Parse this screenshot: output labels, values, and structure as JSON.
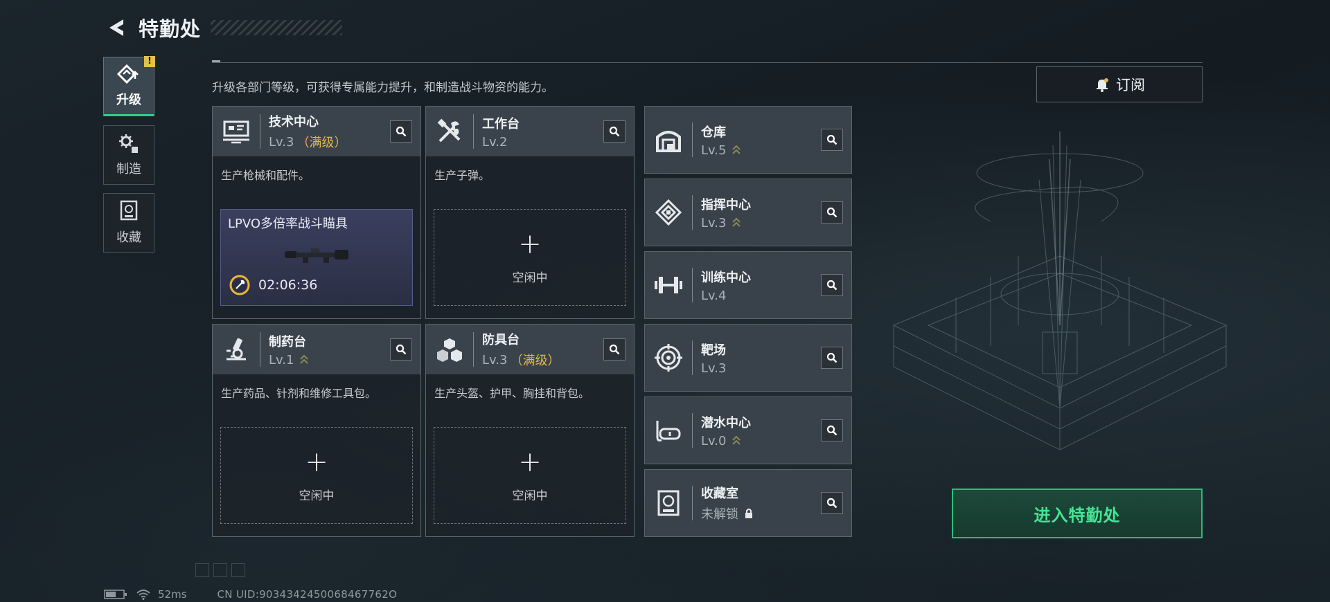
{
  "header": {
    "title": "特勤处"
  },
  "sidebar": {
    "items": [
      {
        "label": "升级",
        "icon": "upgrade-icon",
        "active": true,
        "badge": "!"
      },
      {
        "label": "制造",
        "icon": "gears-icon",
        "active": false
      },
      {
        "label": "收藏",
        "icon": "collection-icon",
        "active": false
      }
    ]
  },
  "description": "升级各部门等级，可获得专属能力提升，和制造战斗物资的能力。",
  "subscribe": {
    "label": "订阅",
    "icon": "bell-icon"
  },
  "departments": [
    {
      "name": "技术中心",
      "level": "Lv.3",
      "max_label": "（满级）",
      "desc": "生产枪械和配件。",
      "slot": {
        "state": "busy",
        "item": "LPVO多倍率战斗瞄具",
        "timer": "02:06:36"
      }
    },
    {
      "name": "工作台",
      "level": "Lv.2",
      "max_label": "",
      "desc": "生产子弹。",
      "slot": {
        "state": "idle",
        "label": "空闲中"
      }
    },
    {
      "name": "制药台",
      "level": "Lv.1",
      "max_label": "",
      "desc": "生产药品、针剂和维修工具包。",
      "slot": {
        "state": "idle",
        "label": "空闲中"
      }
    },
    {
      "name": "防具台",
      "level": "Lv.3",
      "max_label": "（满级）",
      "desc": "生产头盔、护甲、胸挂和背包。",
      "slot": {
        "state": "idle",
        "label": "空闲中"
      }
    }
  ],
  "facilities": [
    {
      "name": "仓库",
      "level": "Lv.5",
      "upgradable": true,
      "icon": "warehouse-icon"
    },
    {
      "name": "指挥中心",
      "level": "Lv.3",
      "upgradable": true,
      "icon": "command-icon"
    },
    {
      "name": "训练中心",
      "level": "Lv.4",
      "upgradable": false,
      "icon": "dumbbell-icon"
    },
    {
      "name": "靶场",
      "level": "Lv.3",
      "upgradable": false,
      "icon": "target-icon"
    },
    {
      "name": "潜水中心",
      "level": "Lv.0",
      "upgradable": true,
      "icon": "diving-mask-icon"
    },
    {
      "name": "收藏室",
      "level": "未解锁",
      "locked": true,
      "icon": "vault-icon"
    }
  ],
  "enter_button": {
    "label": "进入特勤处"
  },
  "status_bar": {
    "ping": "52ms",
    "uid": "CN UID:9034342450068467762O"
  },
  "colors": {
    "accent_green": "#32d186",
    "max_gold": "#e2b64d",
    "chevron_olive": "#8a8a52"
  }
}
